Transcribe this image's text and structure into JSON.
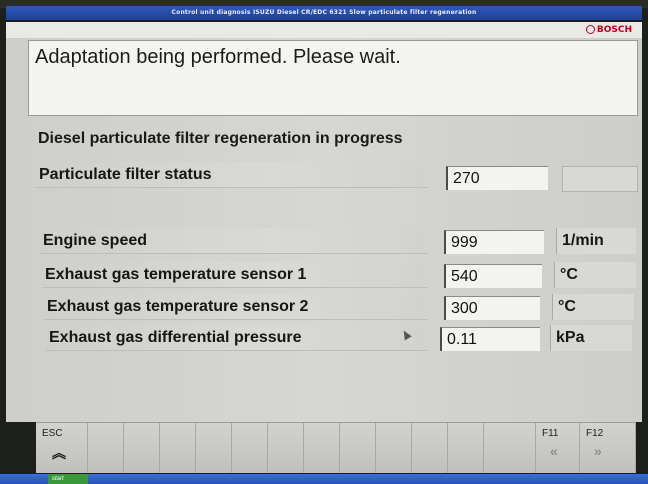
{
  "window": {
    "title": "Control unit diagnosis ISUZU Diesel CR/EDC 6321 Slow particulate filter regeneration",
    "brand": "BOSCH"
  },
  "message": "Adaptation being performed. Please wait.",
  "heading": "Diesel particulate filter regeneration in progress",
  "status": {
    "label": "Particulate filter status",
    "value": "270"
  },
  "readings": [
    {
      "label": "Engine speed",
      "value": "999",
      "unit": "1/min"
    },
    {
      "label": "Exhaust gas temperature sensor 1",
      "value": "540",
      "unit": "°C"
    },
    {
      "label": "Exhaust gas temperature sensor 2",
      "value": "300",
      "unit": "°C"
    },
    {
      "label": "Exhaust gas differential pressure",
      "value": "0.11",
      "unit": "kPa"
    }
  ],
  "function_keys": {
    "esc": {
      "label": "ESC",
      "icon": "double-chevron-up-icon"
    },
    "f11": {
      "label": "F11",
      "icon": "double-chevron-left-icon"
    },
    "f12": {
      "label": "F12",
      "icon": "double-chevron-right-icon"
    }
  },
  "taskbar": {
    "start_label": "start"
  }
}
